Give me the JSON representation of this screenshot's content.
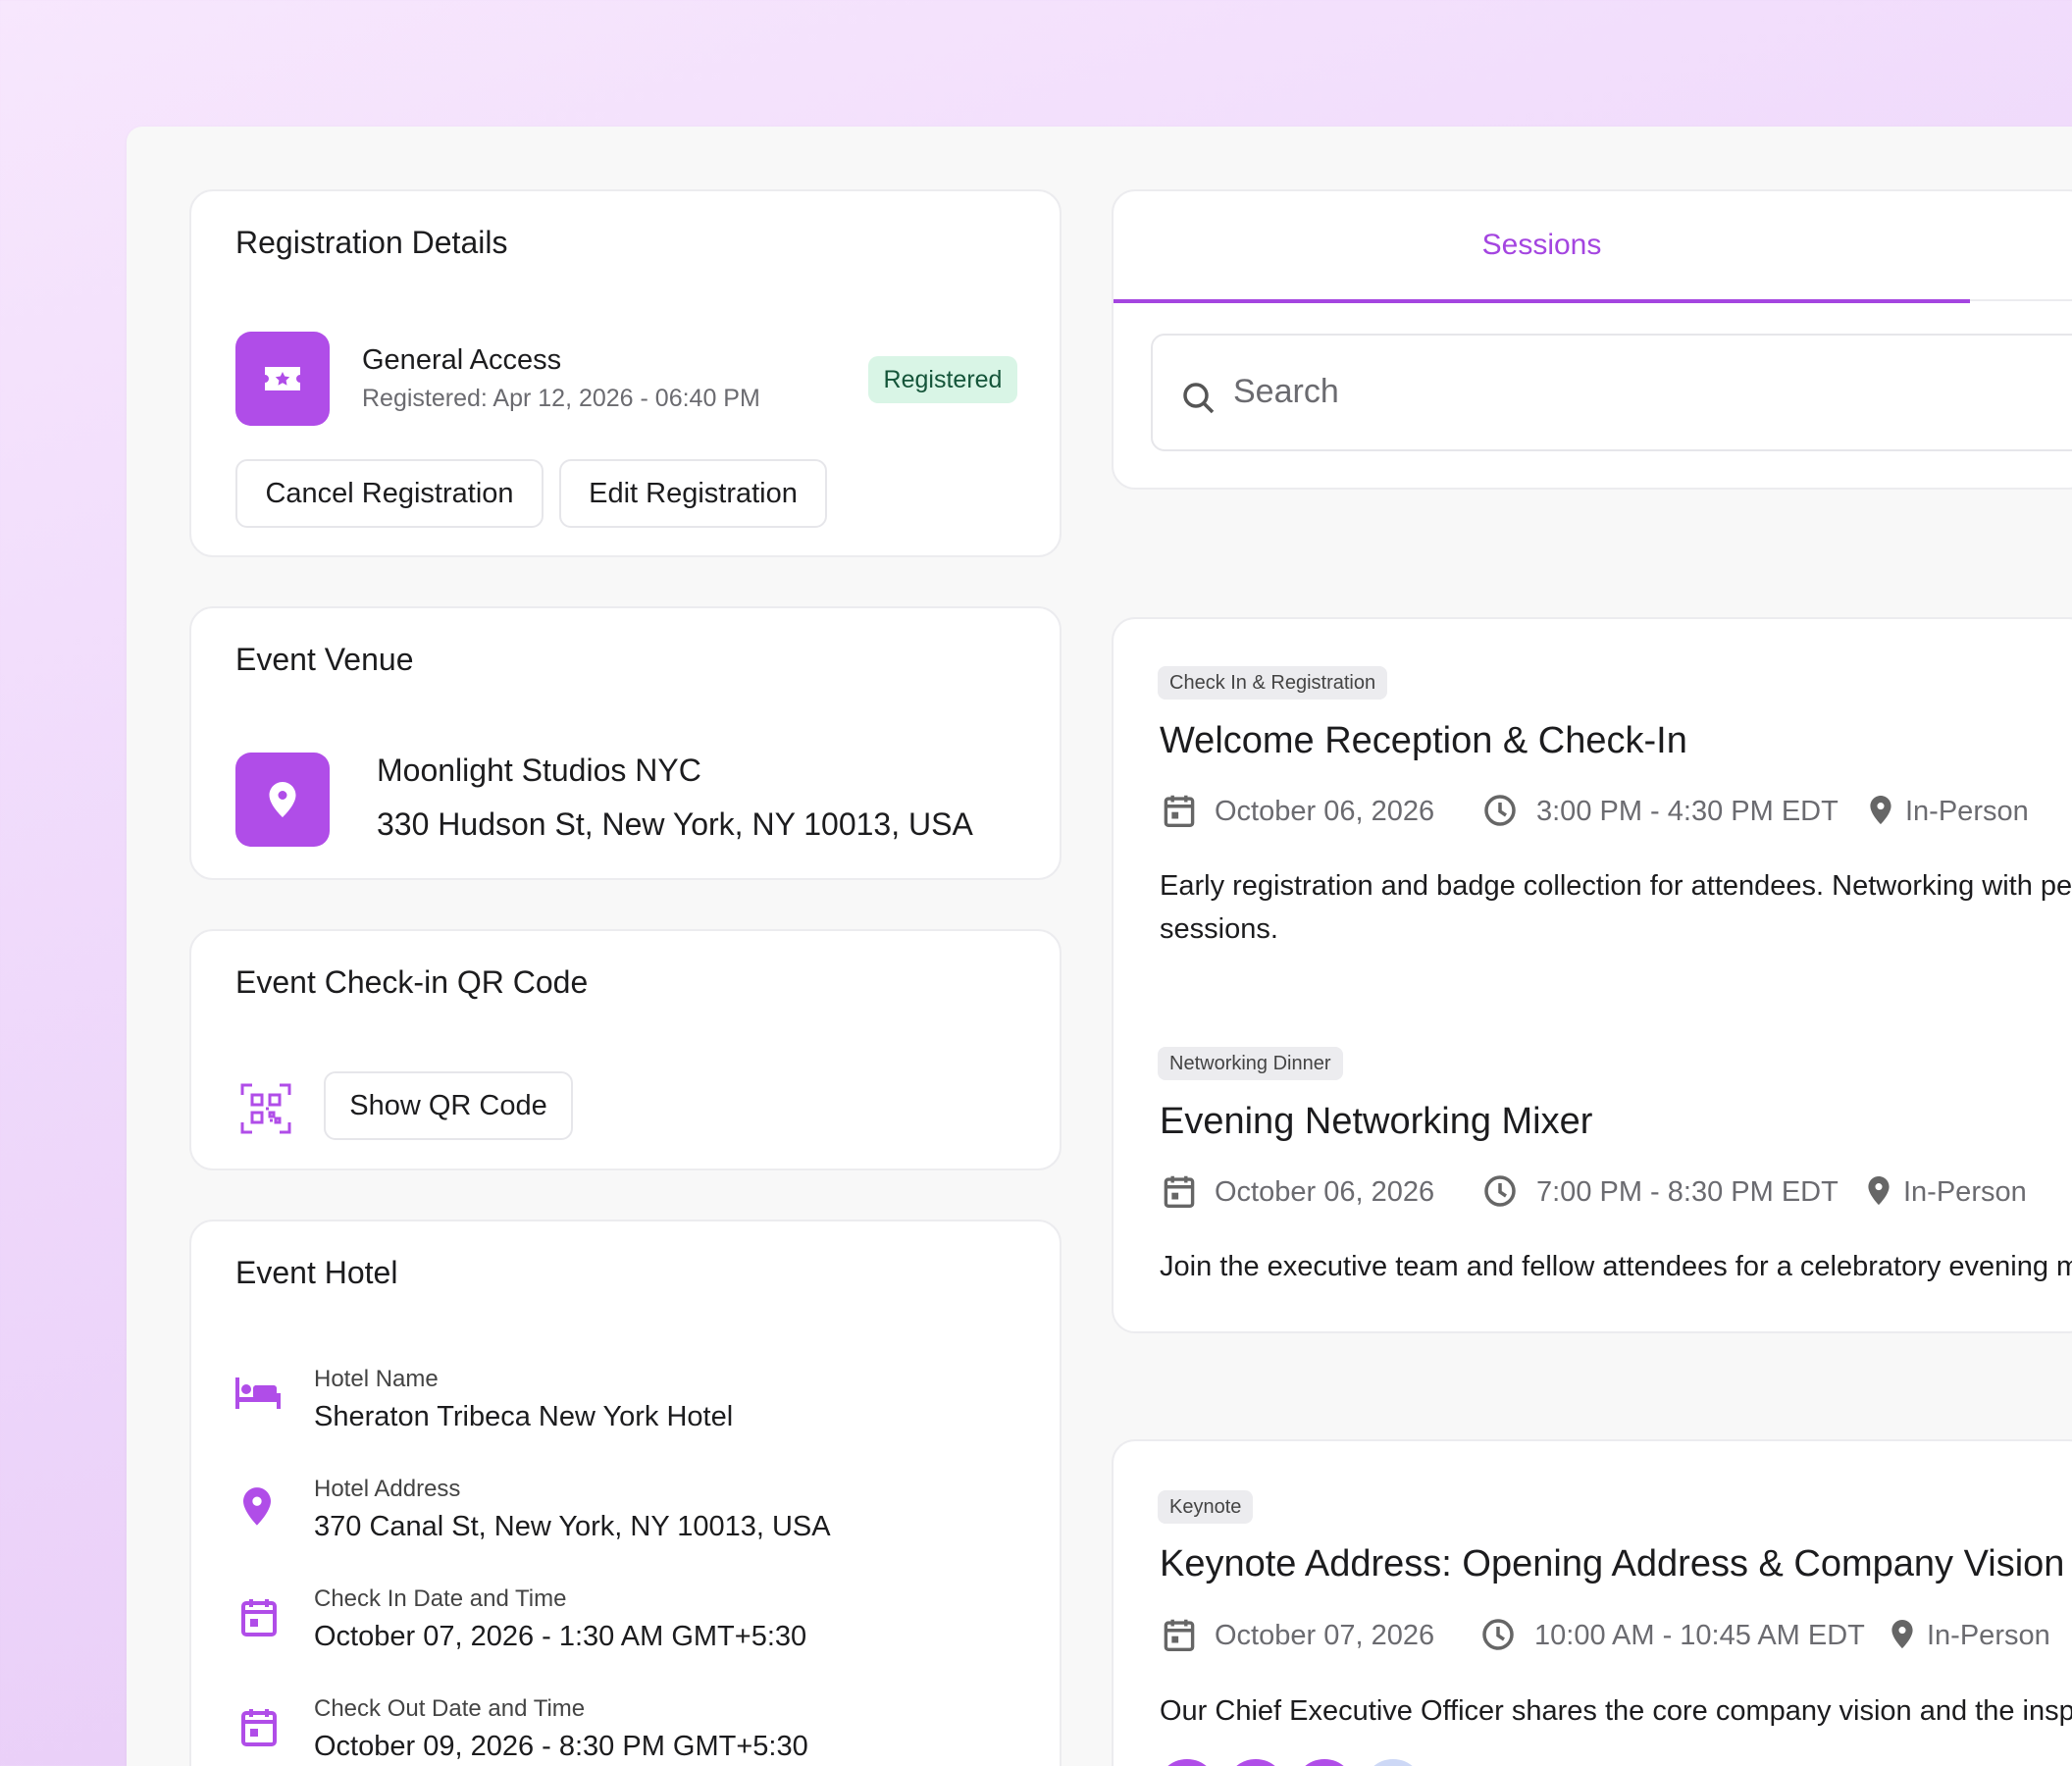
{
  "registration": {
    "title": "Registration Details",
    "ticket_name": "General Access",
    "registered_at": "Registered: Apr 12, 2026 - 06:40 PM",
    "status": "Registered",
    "cancel_label": "Cancel Registration",
    "edit_label": "Edit Registration"
  },
  "venue": {
    "title": "Event Venue",
    "name": "Moonlight Studios NYC",
    "address": "330 Hudson St, New York, NY 10013, USA"
  },
  "qr": {
    "title": "Event Check-in QR Code",
    "button_label": "Show QR Code"
  },
  "hotel": {
    "title": "Event Hotel",
    "rows": [
      {
        "label": "Hotel Name",
        "value": "Sheraton Tribeca New York Hotel",
        "icon": "bed-icon"
      },
      {
        "label": "Hotel Address",
        "value": "370 Canal St, New York, NY 10013, USA",
        "icon": "location-pin-icon"
      },
      {
        "label": "Check In Date and Time",
        "value": "October 07, 2026 - 1:30 AM GMT+5:30",
        "icon": "calendar-icon"
      },
      {
        "label": "Check Out Date and Time",
        "value": "October 09, 2026 - 8:30 PM GMT+5:30",
        "icon": "calendar-icon"
      }
    ]
  },
  "sessions_panel": {
    "tab_label": "Sessions",
    "search_placeholder": "Search"
  },
  "sessions": [
    {
      "tag": "Check In & Registration",
      "title": "Welcome Reception & Check-In",
      "date": "October 06, 2026",
      "time": "3:00 PM - 4:30 PM EDT",
      "location": "In-Person",
      "description_line1": "Early registration and badge collection for attendees. Networking with pe",
      "description_line2": "sessions."
    },
    {
      "tag": "Networking Dinner",
      "title": "Evening Networking Mixer",
      "date": "October 06, 2026",
      "time": "7:00 PM - 8:30 PM EDT",
      "location": "In-Person",
      "description_line1": "Join the executive team and fellow attendees for a celebratory evening m"
    },
    {
      "tag": "Keynote",
      "title": "Keynote Address: Opening Address & Company Vision",
      "date": "October 07, 2026",
      "time": "10:00 AM - 10:45 AM EDT",
      "location": "In-Person",
      "description_line1": "Our Chief Executive Officer shares the core company vision and the inspi"
    }
  ],
  "colors": {
    "accent": "#b04de8",
    "badge_bg": "#d9f5e6",
    "badge_text": "#15553a"
  }
}
